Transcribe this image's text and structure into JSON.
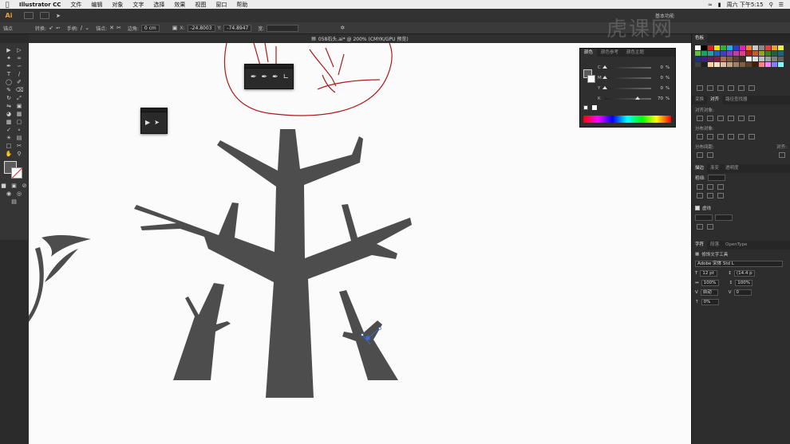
{
  "menubar": {
    "apple": "",
    "app_name": "Illustrator CC",
    "items": [
      "文件",
      "编辑",
      "对象",
      "文字",
      "选择",
      "效果",
      "视图",
      "窗口",
      "帮助"
    ],
    "clock": "周六 下午5:15"
  },
  "appbar": {
    "logo": "Ai",
    "workspace": "基本功能"
  },
  "controlbar": {
    "anchor_label": "锚点",
    "convert_label": "转换:",
    "handle_label": "手柄:",
    "anchor2_label": "锚点:",
    "corner_label": "边角:",
    "corner_value": "0 cm",
    "x_value": "-24.8003",
    "y_value": "-74.8947",
    "w_label": "宽:"
  },
  "document": {
    "tab_title": "058石头.ai* @ 200% (CMYK/GPU 预览)"
  },
  "color_panel": {
    "tabs": [
      "颜色",
      "颜色参考",
      "颜色主题"
    ],
    "sliders": [
      {
        "label": "C",
        "value": "0",
        "unit": "%"
      },
      {
        "label": "M",
        "value": "0",
        "unit": "%"
      },
      {
        "label": "Y",
        "value": "0",
        "unit": "%"
      },
      {
        "label": "K",
        "value": "70",
        "unit": "%"
      }
    ]
  },
  "dock": {
    "swatch_tab": "色板",
    "align_tabs": [
      "变换",
      "对齐",
      "路径查找器"
    ],
    "align_objects_label": "对齐对象:",
    "distribute_objects_label": "分布对象:",
    "distribute_spacing_label": "分布间距:",
    "align_to_label": "对齐:",
    "stroke_tabs": [
      "描边",
      "渐变",
      "透明度"
    ],
    "weight_label": "粗细:",
    "dash_label": "虚线",
    "char_tabs": [
      "字符",
      "段落",
      "OpenType"
    ],
    "touch_type_label": "修饰文字工具",
    "font_name": "Adobe 宋体 Std L",
    "font_size": "12 pt",
    "leading": "(14.4 p",
    "scale_h": "100%",
    "scale_v": "100%",
    "kerning": "自动",
    "tracking": "0",
    "baseline": "0%"
  },
  "watermark": "虎课网",
  "colors": {
    "tree_fill": "#4d4d4d",
    "sketch_red": "#b01818",
    "accent": "#e0a03a"
  },
  "swatches": [
    "#ffffff",
    "#000000",
    "#e02020",
    "#f7e000",
    "#30b030",
    "#20b0e0",
    "#2040d0",
    "#e020c0",
    "#f08030",
    "#c8c8c8",
    "#8a8a8a",
    "#e84040",
    "#f0a020",
    "#f0f040",
    "#60c040",
    "#20a060",
    "#20a0a0",
    "#2060c0",
    "#4040c0",
    "#8040c0",
    "#c040a0",
    "#e04080",
    "#b02020",
    "#c06020",
    "#a0a020",
    "#408020",
    "#206040",
    "#206080",
    "#203080",
    "#402080",
    "#602060",
    "#802040",
    "#a07050",
    "#806040",
    "#604030",
    "#403020",
    "#ffffff",
    "#e0e0e0",
    "#c0c0c0",
    "#a0a0a0",
    "#808080",
    "#606060",
    "#404040",
    "#202020",
    "#ffd0a0",
    "#ffe0c0",
    "#e0c0a0",
    "#c0a080",
    "#a08060",
    "#806040",
    "#604020",
    "#402000",
    "#ff8080",
    "#ff80ff",
    "#8080ff",
    "#80ffff"
  ]
}
